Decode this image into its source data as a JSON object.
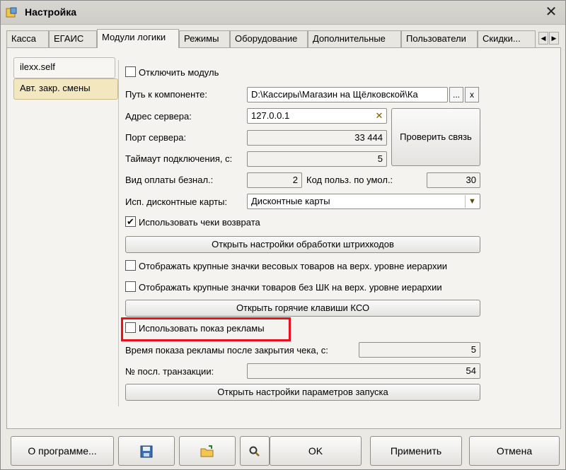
{
  "window": {
    "title": "Настройка",
    "close_icon": "close-icon",
    "app_icon": "settings-app-icon"
  },
  "tabs": [
    {
      "label": "Касса"
    },
    {
      "label": "ЕГАИС"
    },
    {
      "label": "Модули логики"
    },
    {
      "label": "Режимы"
    },
    {
      "label": "Оборудование"
    },
    {
      "label": "Дополнительные"
    },
    {
      "label": "Пользователи"
    },
    {
      "label": "Скидки..."
    }
  ],
  "active_tab_index": 2,
  "tab_scroll": {
    "left": "◀",
    "right": "▶"
  },
  "modules": {
    "items": [
      {
        "label": "ilexx.self"
      },
      {
        "label": "Авт. закр. смены"
      }
    ]
  },
  "form": {
    "disable_module": {
      "label": "Отключить модуль",
      "checked": false
    },
    "component_path": {
      "label": "Путь к компоненте:",
      "value": "D:\\Кассиры\\Магазин на Щёлковской\\Ка",
      "browse_label": "...",
      "clear_label": "x"
    },
    "server_address": {
      "label": "Адрес сервера:",
      "value": "127.0.0.1",
      "clear_icon": "clear-icon"
    },
    "check_connection_label": "Проверить связь",
    "server_port": {
      "label": "Порт сервера:",
      "value": "33 444"
    },
    "timeout": {
      "label": "Таймаут подключения, с:",
      "value": "5"
    },
    "payment_type": {
      "label": "Вид оплаты безнал.:",
      "value": "2"
    },
    "default_user_code": {
      "label": "Код польз. по умол.:",
      "value": "30"
    },
    "discount_cards": {
      "label": "Исп. дисконтные карты:",
      "value": "Дисконтные карты",
      "dropdown_icon": "chevron-down-icon"
    },
    "use_return_receipts": {
      "label": "Использовать чеки возврата",
      "checked": true
    },
    "barcode_settings_label": "Открыть настройки обработки штрихкодов",
    "large_weight_icons": {
      "label": "Отображать крупные значки весовых товаров на верх. уровне иерархии",
      "checked": false
    },
    "large_nobarcode_icons": {
      "label": "Отображать крупные значки товаров без ШК на верх. уровне иерархии",
      "checked": false
    },
    "hotkeys_label": "Открыть горячие клавиши КСО",
    "use_ads": {
      "label": "Использовать показ рекламы",
      "checked": false
    },
    "ads_time": {
      "label": "Время показа рекламы после закрытия чека, с:",
      "value": "5"
    },
    "last_transaction": {
      "label": "№ посл. транзакции:",
      "value": "54"
    },
    "launch_params_label": "Открыть настройки параметров запуска"
  },
  "bottom": {
    "about_label": "О программе...",
    "save_icon": "save-icon",
    "open_folder_icon": "open-folder-icon",
    "search_icon": "search-icon",
    "ok_label": "OK",
    "apply_label": "Применить",
    "cancel_label": "Отмена"
  },
  "colors": {
    "highlight": "#e8101a",
    "window_bg": "#ebe9e4",
    "vtab_inactive": "#f3e7c0"
  }
}
